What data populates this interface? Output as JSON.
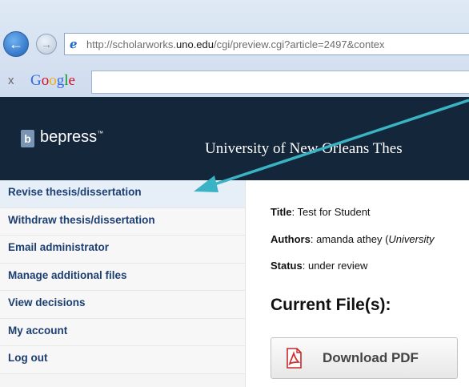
{
  "browser": {
    "url_prefix": "http://scholarworks.",
    "url_domain": "uno.edu",
    "url_suffix": "/cgi/preview.cgi?article=2497&contex",
    "google_bar": {
      "close": "x",
      "logo_letters": [
        "G",
        "o",
        "o",
        "g",
        "l",
        "e"
      ],
      "logo_colors": [
        "#3369e8",
        "#d50f25",
        "#eeb211",
        "#3369e8",
        "#009925",
        "#d50f25"
      ]
    }
  },
  "header": {
    "logo_mark": "b",
    "logo_text": "bepress",
    "logo_tm": "™",
    "site_title": "University of New Orleans Thes"
  },
  "sidebar": {
    "items": [
      {
        "label": "Revise thesis/dissertation"
      },
      {
        "label": "Withdraw thesis/dissertation"
      },
      {
        "label": "Email administrator"
      },
      {
        "label": "Manage additional files"
      },
      {
        "label": "View decisions"
      },
      {
        "label": "My account"
      },
      {
        "label": "Log out"
      }
    ]
  },
  "main": {
    "title_key": "Title",
    "title_value": ": Test for Student",
    "authors_key": "Authors",
    "authors_value": ": amanda athey (",
    "authors_affil": "University",
    "status_key": "Status",
    "status_value": ": under review",
    "section_heading": "Current File(s):",
    "download_label": "Download PDF"
  },
  "colors": {
    "header_bg": "#14263a",
    "sidebar_link": "#1c3f72",
    "annotation_arrow": "#3ab3c4"
  },
  "icons": {
    "back": "back-arrow-icon",
    "forward": "forward-arrow-icon",
    "page": "ie-page-icon",
    "pdf": "pdf-icon"
  }
}
